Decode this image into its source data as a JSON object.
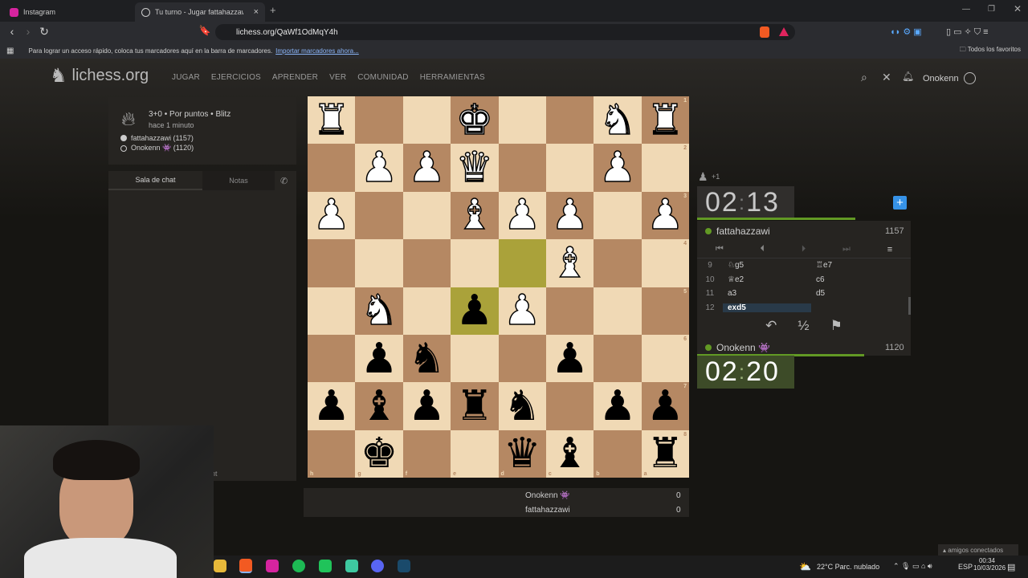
{
  "tabs": [
    {
      "label": "Instagram",
      "active": false
    },
    {
      "label": "Tu turno - Jugar fattahazzawi",
      "active": true
    }
  ],
  "address": "lichess.org/QaWf1OdMqY4h",
  "bookmarks": {
    "text": "Para lograr un acceso rápido, coloca tus marcadores aquí en la barra de marcadores.",
    "link": "Importar marcadores ahora...",
    "all_favorites": "Todos los favoritos"
  },
  "site": {
    "logo": "lichess.org",
    "nav": [
      "JUGAR",
      "EJERCICIOS",
      "APRENDER",
      "VER",
      "COMUNIDAD",
      "HERRAMIENTAS"
    ],
    "user": "Onokenn"
  },
  "game_info": {
    "mode": "3+0 • Por puntos • Blitz",
    "time_ago": "hace 1 minuto",
    "white": "fattahazzawi (1157)",
    "black": "Onokenn 👾 (1120)"
  },
  "chat": {
    "tab_chat": "Sala de chat",
    "tab_notes": "Notas",
    "partial_text": "nt"
  },
  "board": {
    "highlight": [
      "e5",
      "d4"
    ],
    "rows": [
      [
        "wR",
        "",
        "",
        "wK",
        "",
        "",
        "wN",
        "wR"
      ],
      [
        "",
        "wP",
        "wP",
        "wQ",
        "",
        "",
        "wP",
        ""
      ],
      [
        "wP",
        "",
        "",
        "wB",
        "wP",
        "wP",
        "",
        "wP"
      ],
      [
        "",
        "",
        "",
        "",
        "",
        "wB",
        "",
        ""
      ],
      [
        "",
        "wN",
        "",
        "bP",
        "wP",
        "",
        "",
        ""
      ],
      [
        "",
        "bP",
        "bN",
        "",
        "",
        "bP",
        "",
        ""
      ],
      [
        "bP",
        "bB",
        "bP",
        "bR",
        "bN",
        "",
        "bP",
        "bP"
      ],
      [
        "",
        "bK",
        "",
        "",
        "bQ",
        "bB",
        "",
        "bR"
      ]
    ],
    "rank_labels": [
      "1",
      "2",
      "3",
      "4",
      "5",
      "6",
      "7",
      "8"
    ],
    "file_labels": [
      "h",
      "g",
      "f",
      "e",
      "d",
      "c",
      "b",
      "a"
    ]
  },
  "players": {
    "top": {
      "name": "fattahazzawi",
      "rating": "1157",
      "clock_min": "02",
      "clock_sec": "13",
      "captured": "+1"
    },
    "bottom": {
      "name": "Onokenn 👾",
      "rating": "1120",
      "clock_min": "02",
      "clock_sec": "20"
    }
  },
  "moves": [
    {
      "n": "9",
      "w": "♘g5",
      "b": "♖e7"
    },
    {
      "n": "10",
      "w": "♕e2",
      "b": "c6"
    },
    {
      "n": "11",
      "w": "a3",
      "b": "d5"
    },
    {
      "n": "12",
      "w": "exd5",
      "b": ""
    }
  ],
  "score": [
    {
      "name": "Onokenn 👾",
      "points": "0"
    },
    {
      "name": "fattahazzawi",
      "points": "0"
    }
  ],
  "taskbar": {
    "weather": "22°C  Parc. nublado",
    "lang": "ESP",
    "time": "00:34",
    "date": "10/03/2026",
    "friends": "amigos conectados"
  },
  "colors": {
    "accent_green": "#629924",
    "board_light": "#f0d9b5",
    "board_dark": "#b58863"
  }
}
